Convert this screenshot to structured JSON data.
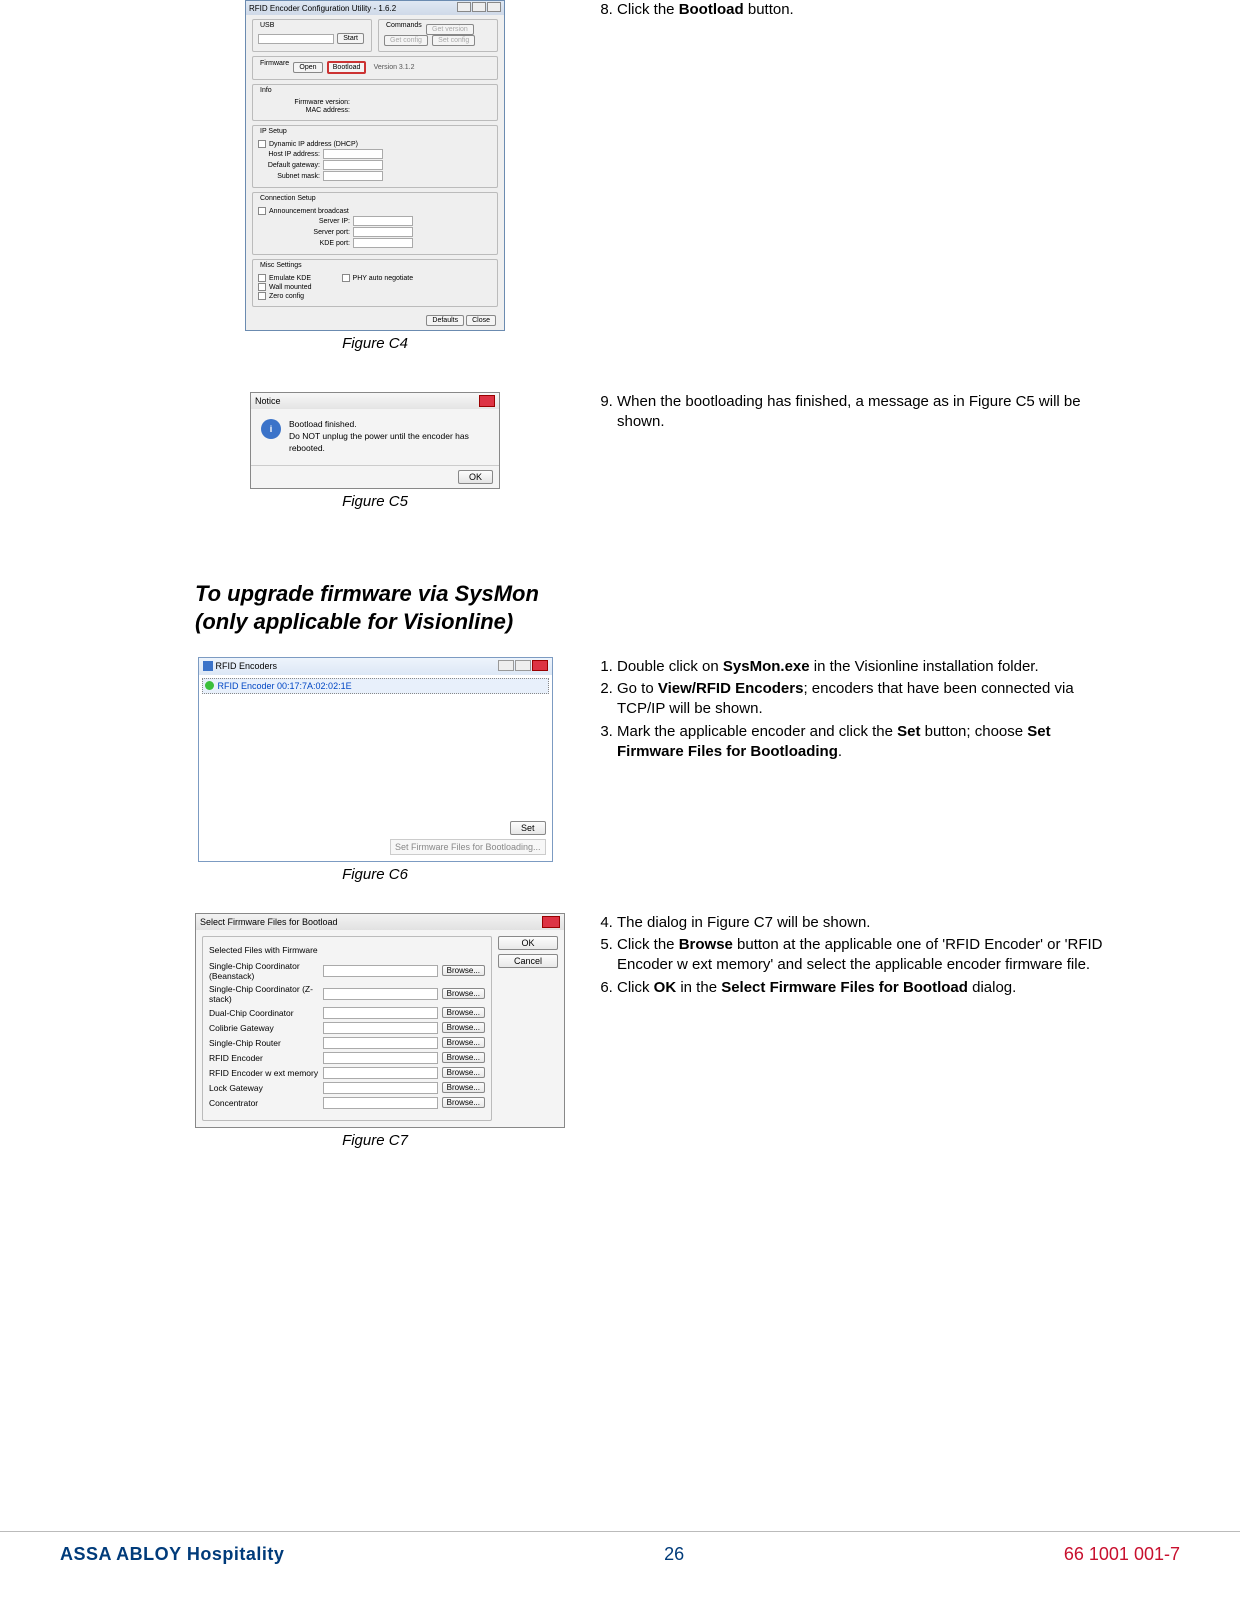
{
  "step8": {
    "num": "8.",
    "text_a": "Click the ",
    "bold": "Bootload",
    "text_b": " button."
  },
  "figC4": {
    "title": "RFID Encoder Configuration Utility - 1.6.2",
    "groups": {
      "usb": "USB",
      "firmware": "Firmware",
      "commands": "Commands",
      "info": "Info",
      "ipsetup": "IP Setup",
      "connsetup": "Connection Setup",
      "misc": "Misc Settings"
    },
    "buttons": {
      "start": "Start",
      "open": "Open",
      "bootload": "Bootload",
      "get_version": "Get version",
      "get_config": "Get config",
      "set_config": "Set config",
      "defaults": "Defaults",
      "close": "Close"
    },
    "fields": {
      "fw_version_static": "Version 3.1.2",
      "fw_version": "Firmware version:",
      "mac": "MAC address:",
      "dhcp": "Dynamic IP address (DHCP)",
      "hostip": "Host IP address:",
      "gateway": "Default gateway:",
      "subnet": "Subnet mask:",
      "announce": "Announcement broadcast",
      "serverip": "Server IP:",
      "serverport": "Server port:",
      "kdeport": "KDE port:",
      "emulate": "Emulate KDE",
      "wall": "Wall mounted",
      "zero": "Zero config",
      "phyauto": "PHY auto negotiate"
    },
    "caption": "Figure C4"
  },
  "step9": {
    "num": "9.",
    "text": "When the bootloading has finished, a message as in Figure C5 will be shown."
  },
  "figC5": {
    "title": "Notice",
    "line1": "Bootload finished.",
    "line2": "Do NOT unplug the power until the encoder has rebooted.",
    "ok": "OK",
    "caption": "Figure C5"
  },
  "sectionTitle": {
    "line1": "To upgrade firmware via SysMon",
    "line2": "(only applicable for Visionline)"
  },
  "figC6": {
    "title": "RFID Encoders",
    "item": "RFID Encoder 00:17:7A:02:02:1E",
    "setBtn": "Set",
    "menuItem": "Set Firmware Files for Bootloading...",
    "caption": "Figure C6"
  },
  "steps1_3": {
    "s1a": "Double click on ",
    "s1b": "SysMon.exe",
    "s1c": " in the Visionline installation folder.",
    "s2a": "Go to ",
    "s2b": "View/RFID Encoders",
    "s2c": "; encoders that have been connected via TCP/IP will be shown.",
    "s3a": "Mark the applicable encoder and click the ",
    "s3b": "Set",
    "s3c": " button; choose ",
    "s3d": "Set Firmware Files for Bootloading",
    "s3e": "."
  },
  "figC7": {
    "title": "Select Firmware Files for Bootload",
    "groupTitle": "Selected Files with Firmware",
    "rows": [
      "Single-Chip Coordinator (Beanstack)",
      "Single-Chip Coordinator (Z-stack)",
      "Dual-Chip Coordinator",
      "Colibrie Gateway",
      "Single-Chip Router",
      "RFID Encoder",
      "RFID Encoder w ext memory",
      "Lock Gateway",
      "Concentrator"
    ],
    "browse": "Browse...",
    "ok": "OK",
    "cancel": "Cancel",
    "caption": "Figure C7"
  },
  "steps4_6": {
    "s4": "The dialog in Figure C7 will be shown.",
    "s5a": "Click the ",
    "s5b": "Browse",
    "s5c": " button at the applicable one of 'RFID Encoder' or 'RFID Encoder w ext memory' and select the applicable encoder firmware file.",
    "s6a": "Click ",
    "s6b": "OK",
    "s6c": " in the ",
    "s6d": "Select Firmware Files for Bootload",
    "s6e": " dialog."
  },
  "footer": {
    "brand": "ASSA ABLOY Hospitality",
    "page": "26",
    "doc": "66 1001 001-7"
  }
}
